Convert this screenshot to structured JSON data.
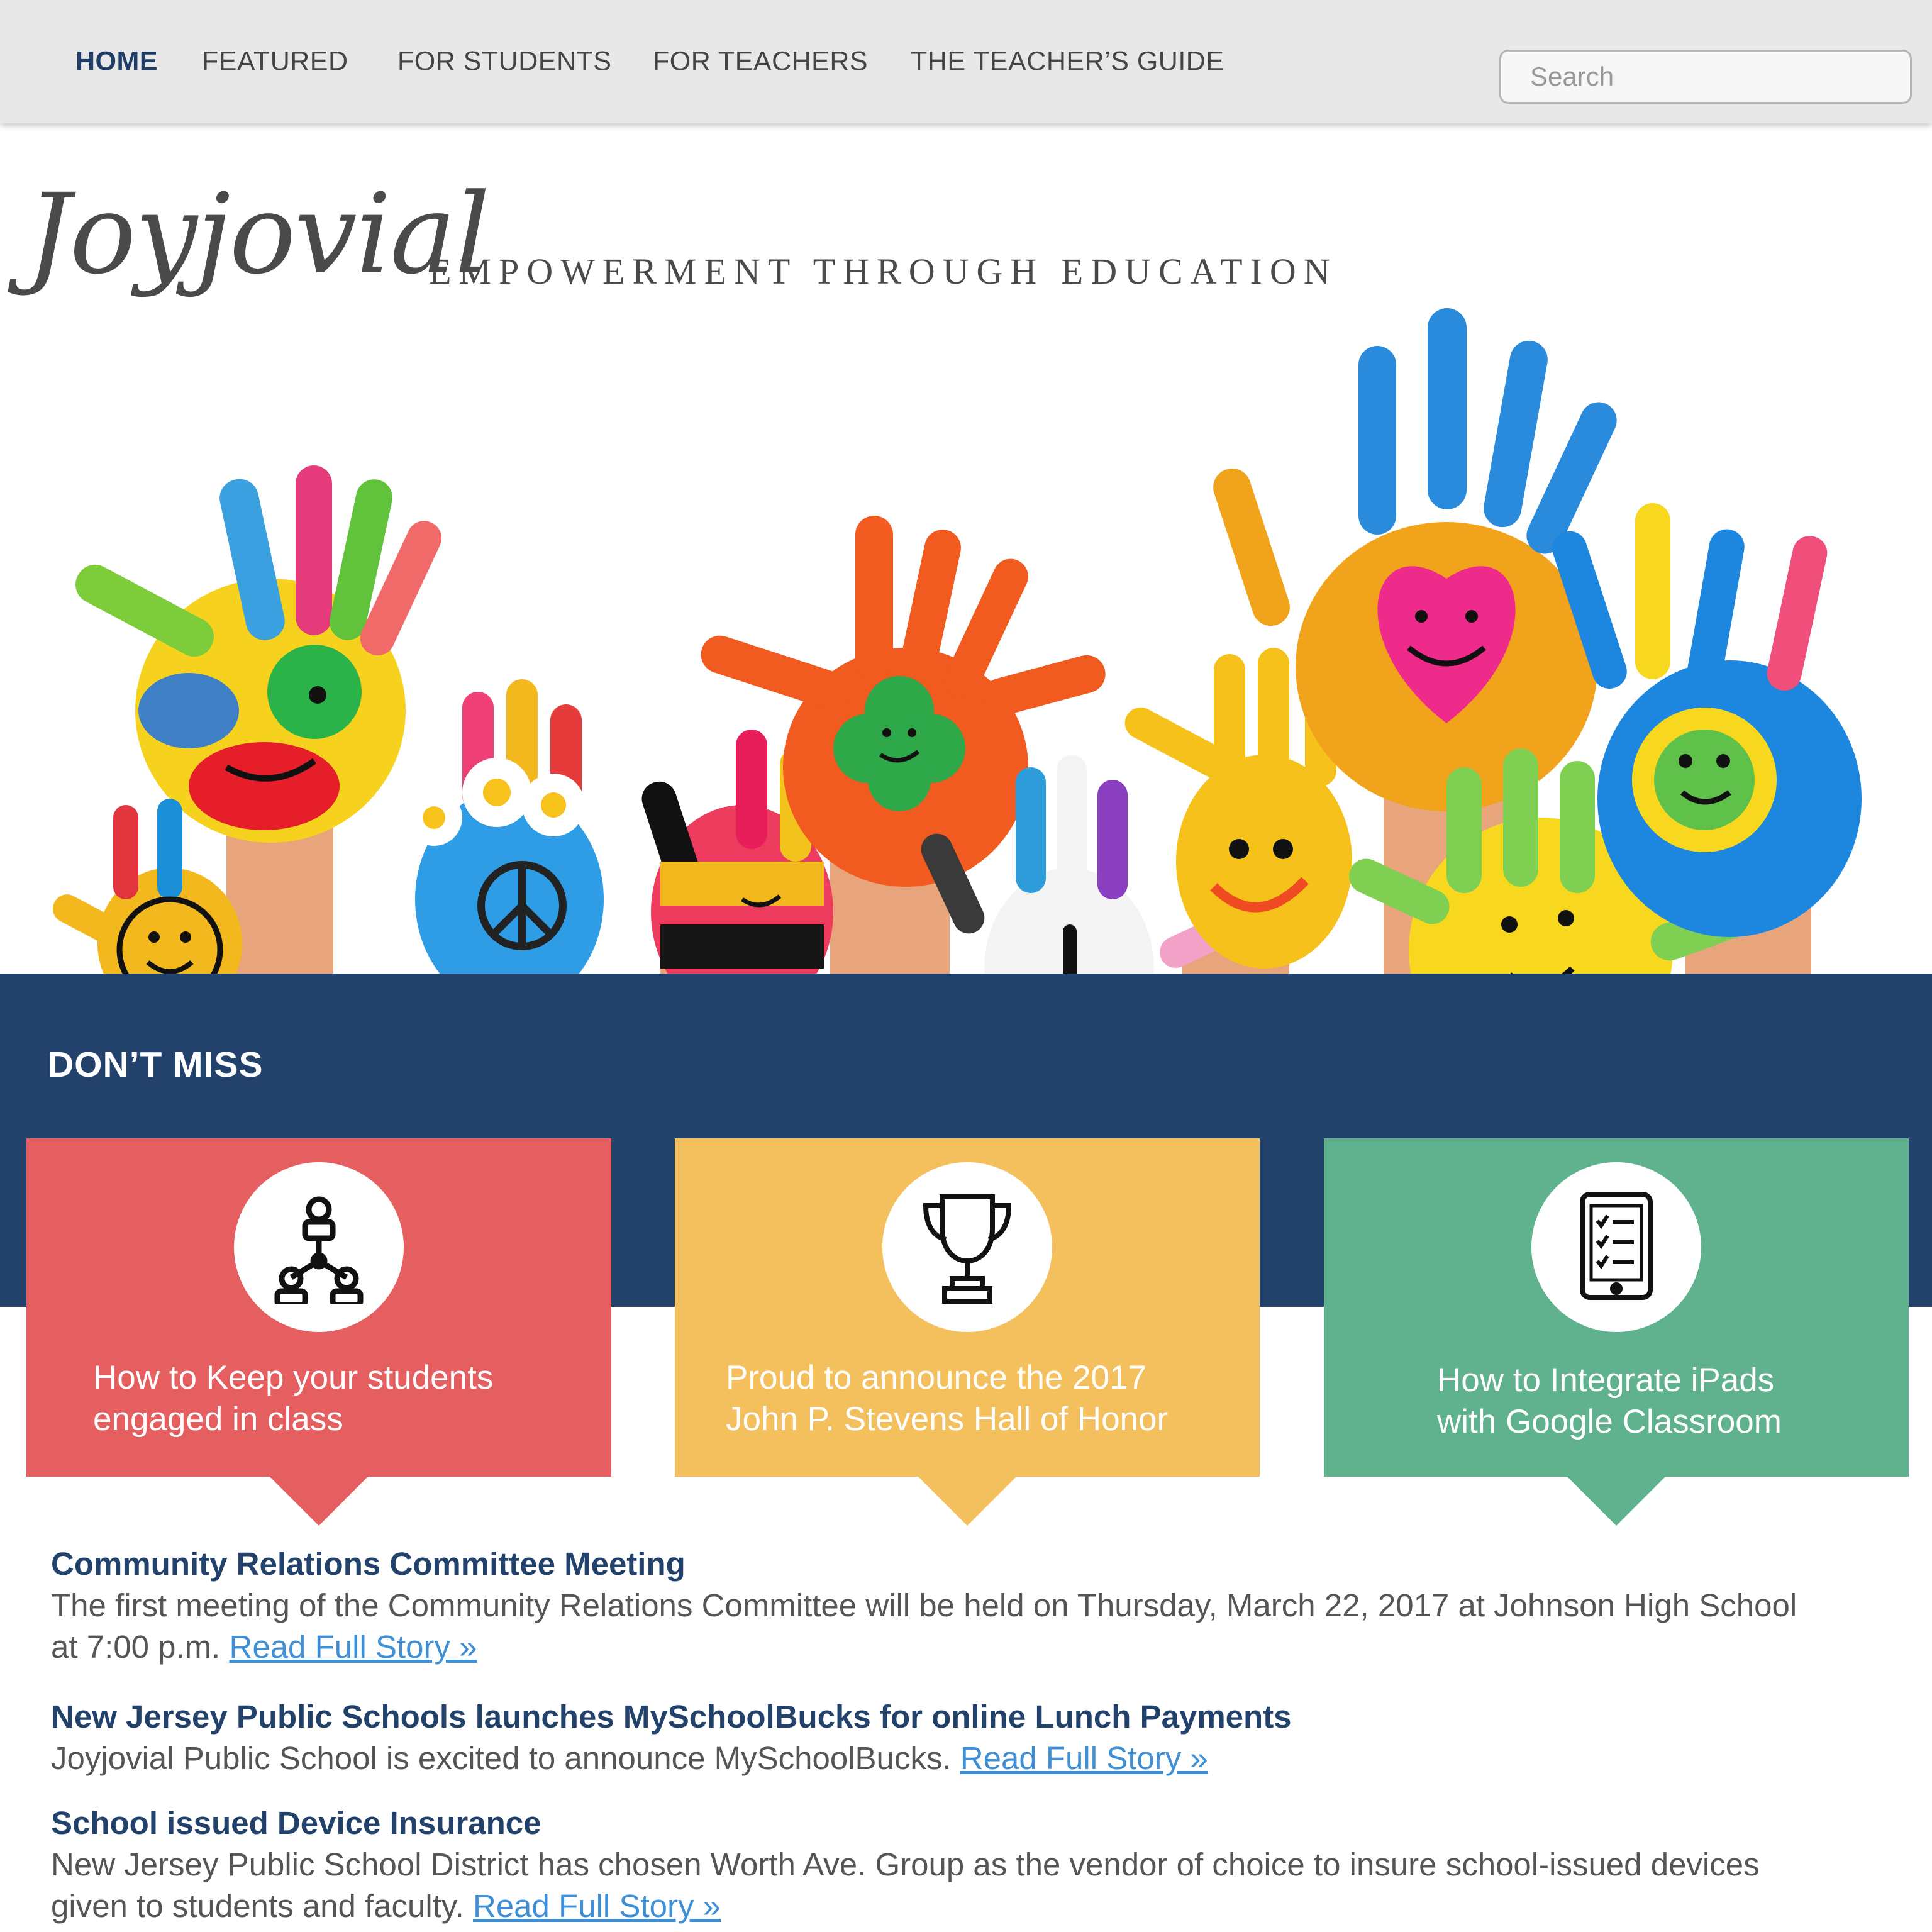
{
  "nav": {
    "items": [
      {
        "label": "HOME",
        "active": true
      },
      {
        "label": "FEATURED",
        "active": false
      },
      {
        "label": "FOR STUDENTS",
        "active": false
      },
      {
        "label": "FOR TEACHERS",
        "active": false
      },
      {
        "label": "THE TEACHER’S GUIDE",
        "active": false
      }
    ],
    "search_placeholder": "Search"
  },
  "hero": {
    "brand": "Joyjovial",
    "tagline": "EMPOWERMENT THROUGH EDUCATION"
  },
  "dont_miss": {
    "title": "DON’T MISS",
    "cards": [
      {
        "icon": "team-hierarchy-icon",
        "line1": "How to Keep your students",
        "line2": "engaged in class",
        "color": "#e55e60"
      },
      {
        "icon": "trophy-icon",
        "line1": "Proud to announce the 2017",
        "line2": "John P. Stevens Hall of Honor",
        "color": "#f4bf5d"
      },
      {
        "icon": "tablet-checklist-icon",
        "line1": "How to Integrate iPads",
        "line2": "with Google Classroom",
        "color": "#60b18d"
      }
    ]
  },
  "news": [
    {
      "title": "Community Relations Committee Meeting",
      "line1": "The first meeting of the Community Relations Committee will be held on Thursday, March 22, 2017 at Johnson High School",
      "line2": "at 7:00 p.m.",
      "link": "Read Full Story »"
    },
    {
      "title": "New Jersey Public Schools launches MySchoolBucks for online Lunch Payments",
      "line1": "Joyjovial Public School is excited to announce MySchoolBucks.",
      "link": "Read Full Story »"
    },
    {
      "title": "School issued Device Insurance",
      "line1": "New Jersey Public School District has chosen Worth Ave. Group as the vendor of choice to insure school-issued devices",
      "line2": "given to students and faculty.",
      "link": "Read Full Story »"
    }
  ],
  "colors": {
    "nav_bg": "#e8e8e8",
    "accent_navy": "#22426b",
    "link_blue": "#3f8fd6"
  }
}
